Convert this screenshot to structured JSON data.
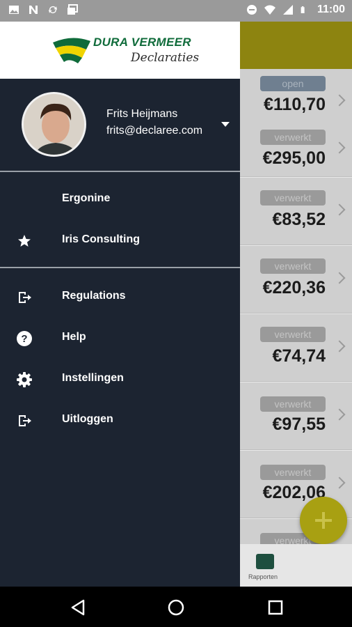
{
  "status_bar": {
    "time": "11:00",
    "left_icons": [
      "image-icon",
      "n-icon",
      "sync-icon",
      "photo-stack-icon"
    ],
    "right_icons": [
      "do-not-disturb-icon",
      "wifi-icon",
      "signal-icon",
      "battery-icon"
    ]
  },
  "background_app": {
    "rows": [
      {
        "status": "open",
        "amount": "€110,70"
      },
      {
        "status": "verwerkt",
        "amount": "€295,00"
      },
      {
        "status": "verwerkt",
        "amount": "€83,52"
      },
      {
        "status": "verwerkt",
        "amount": "€220,36"
      },
      {
        "status": "verwerkt",
        "amount": "€74,74"
      },
      {
        "status": "verwerkt",
        "amount": "€97,55"
      },
      {
        "status": "verwerkt",
        "amount": "€202,06"
      },
      {
        "status": "verwerkt",
        "amount": ""
      }
    ],
    "bottom_tab": {
      "label": "Rapporten"
    },
    "colors": {
      "header": "#8d8410",
      "fab": "#a8a012"
    }
  },
  "drawer": {
    "logo": {
      "title": "DURA VERMEER",
      "subtitle": "Declaraties"
    },
    "user": {
      "name": "Frits Heijmans",
      "email": "frits@declaree.com"
    },
    "companies": [
      {
        "label": "Ergonine",
        "icon": ""
      },
      {
        "label": "Iris Consulting",
        "icon": "star-icon"
      }
    ],
    "menu": [
      {
        "label": "Regulations",
        "icon": "exit-icon"
      },
      {
        "label": "Help",
        "icon": "help-icon"
      },
      {
        "label": "Instellingen",
        "icon": "gear-icon"
      },
      {
        "label": "Uitloggen",
        "icon": "logout-icon"
      }
    ],
    "colors": {
      "background": "#1c2431",
      "brand": "#0f6b3a"
    }
  },
  "nav_bar": {
    "buttons": [
      "back-icon",
      "home-icon",
      "recents-icon"
    ]
  }
}
